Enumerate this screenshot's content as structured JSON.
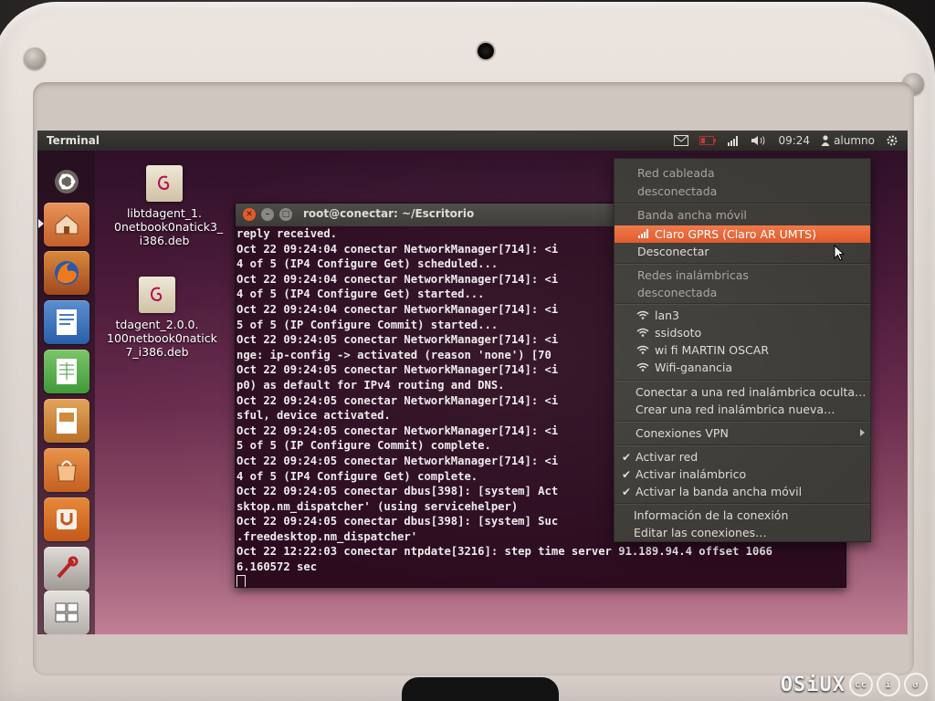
{
  "panel": {
    "title": "Terminal",
    "clock": "09:24",
    "user": "alumno"
  },
  "desktop": {
    "icons": [
      {
        "label": "libtdagent_1.\n0netbook0natick3_\ni386.deb"
      },
      {
        "label": "tdagent_2.0.0.\n100netbook0natick\n7_i386.deb"
      }
    ]
  },
  "launcher": {
    "items": [
      "ubuntu-logo-icon",
      "home-folder-icon",
      "firefox-icon",
      "writer-icon",
      "calc-icon",
      "impress-icon",
      "software-center-icon",
      "ubuntu-one-icon",
      "update-icon",
      "workspaces-icon"
    ]
  },
  "terminal": {
    "title": "root@conectar: ~/Escritorio",
    "lines": [
      "reply received.",
      "Oct 22 09:24:04 conectar NetworkManager[714]: <i",
      "4 of 5 (IP4 Configure Get) scheduled...",
      "Oct 22 09:24:04 conectar NetworkManager[714]: <i",
      "4 of 5 (IP4 Configure Get) started...",
      "Oct 22 09:24:04 conectar NetworkManager[714]: <i",
      "5 of 5 (IP Configure Commit) started...",
      "Oct 22 09:24:05 conectar NetworkManager[714]: <i",
      "nge: ip-config -> activated (reason 'none') [70 ",
      "Oct 22 09:24:05 conectar NetworkManager[714]: <i",
      "p0) as default for IPv4 routing and DNS.",
      "Oct 22 09:24:05 conectar NetworkManager[714]: <i",
      "sful, device activated.",
      "Oct 22 09:24:05 conectar NetworkManager[714]: <i",
      "5 of 5 (IP Configure Commit) complete.",
      "Oct 22 09:24:05 conectar NetworkManager[714]: <i",
      "4 of 5 (IP4 Configure Get) complete.",
      "Oct 22 09:24:05 conectar dbus[398]: [system] Act",
      "sktop.nm_dispatcher' (using servicehelper)",
      "Oct 22 09:24:05 conectar dbus[398]: [system] Suc",
      ".freedesktop.nm_dispatcher'",
      "Oct 22 12:22:03 conectar ntpdate[3216]: step time server 91.189.94.4 offset 1066",
      "6.160572 sec"
    ]
  },
  "network_menu": {
    "wired_header": "Red cableada",
    "wired_status": "desconectada",
    "mobile_header": "Banda ancha móvil",
    "mobile_active": "Claro GPRS (Claro AR UMTS)",
    "disconnect": "Desconectar",
    "wireless_header": "Redes inalámbricas",
    "wireless_status": "desconectada",
    "networks": [
      "lan3",
      "ssidsoto",
      "wi fi MARTIN OSCAR",
      "Wifi-ganancia"
    ],
    "connect_hidden": "Conectar a una red inalámbrica oculta…",
    "create_new": "Crear una red inalámbrica nueva…",
    "vpn": "Conexiones VPN",
    "enable_network": "Activar red",
    "enable_wireless": "Activar inalámbrico",
    "enable_mobile": "Activar la banda ancha móvil",
    "connection_info": "Información de la conexión",
    "edit_connections": "Editar las conexiones…"
  },
  "watermark": {
    "text": "OSiUX"
  },
  "colors": {
    "highlight": "#e8632f",
    "panel": "#3c3b37",
    "terminal_bg": "#2c0b1f"
  }
}
